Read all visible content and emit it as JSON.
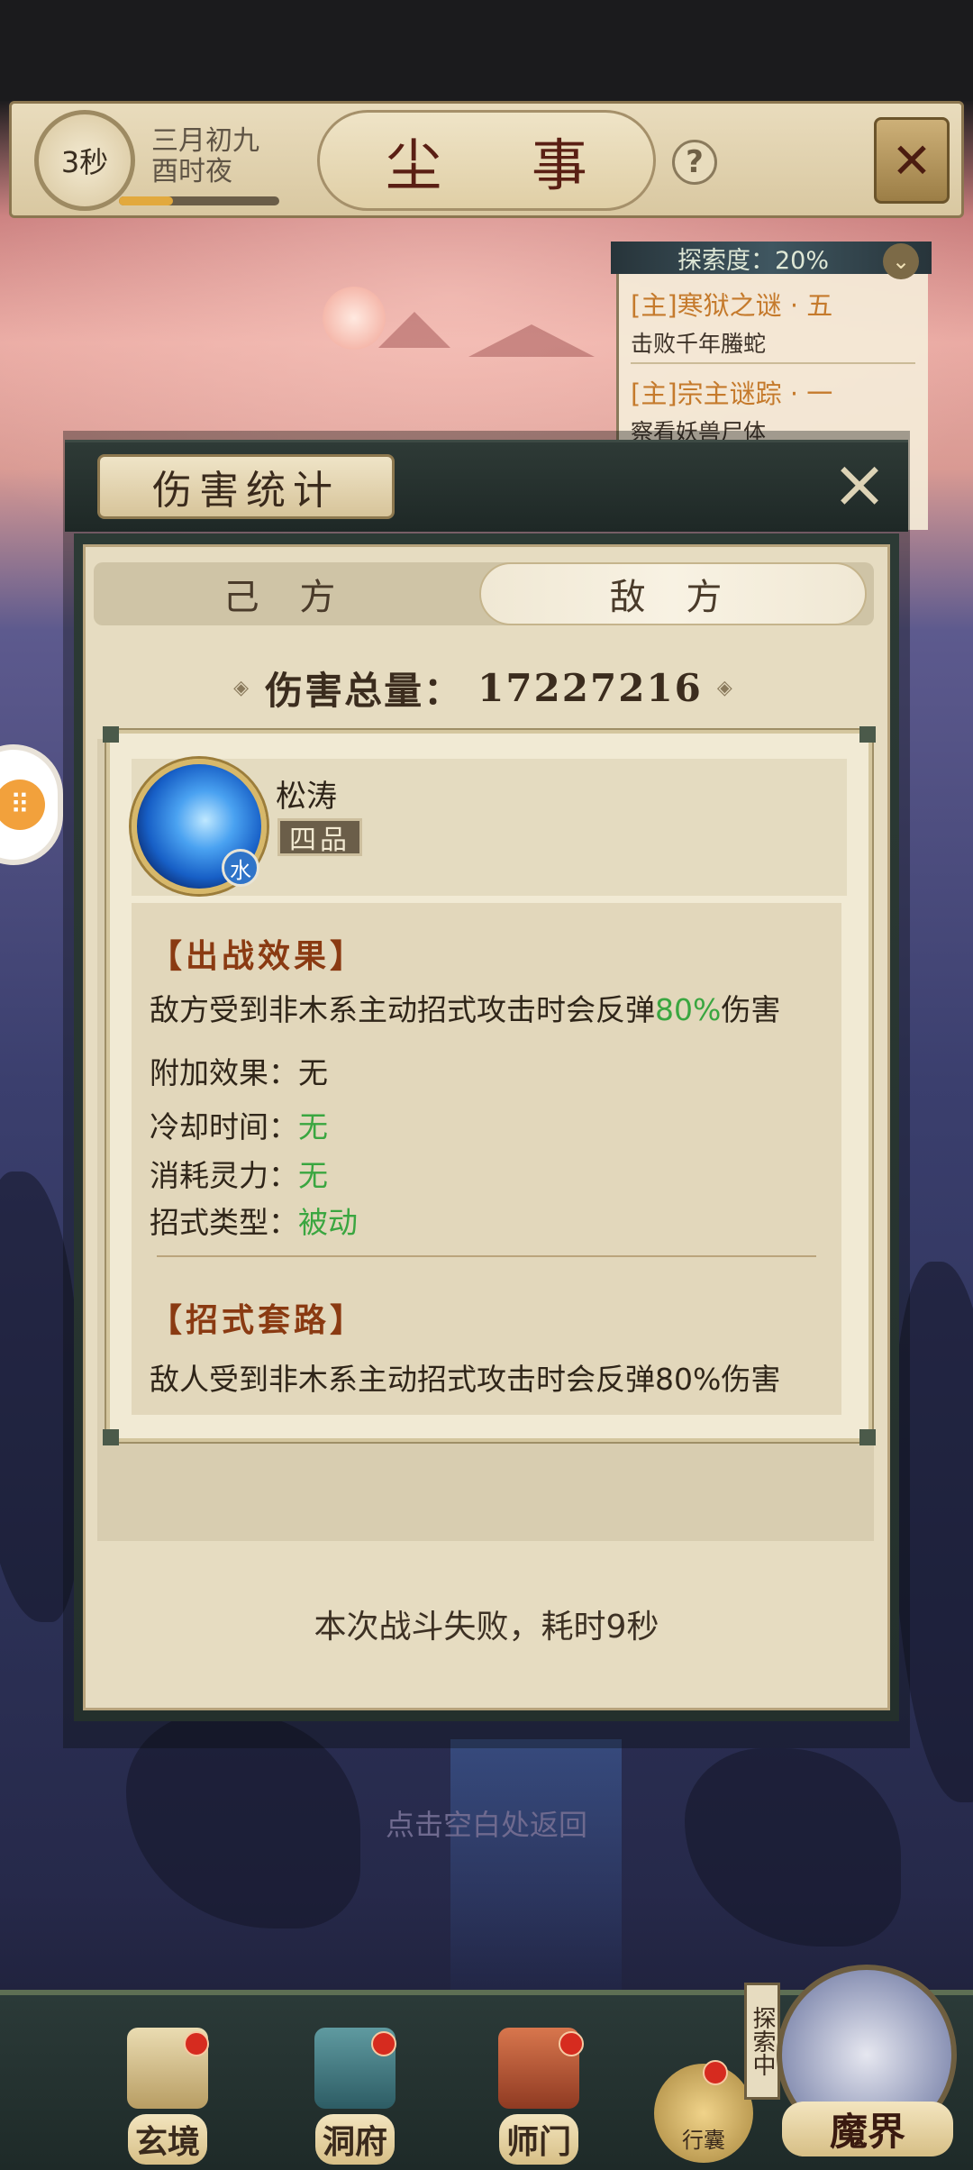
{
  "header": {
    "time_seconds": "3秒",
    "date_line1": "三月初九",
    "date_line2": "酉时夜",
    "title": "尘 事",
    "help_icon": "question-mark-icon",
    "map_icon": "crossed-swords-icon"
  },
  "quest_panel": {
    "explore_label": "探索度：20%",
    "explore_progress": 0.2,
    "quests": [
      {
        "title": "[主]寒狱之谜 · 五",
        "subtitle": "击败千年螣蛇"
      },
      {
        "title": "[主]宗主谜踪 · 一",
        "subtitle": "察看妖兽尸体"
      }
    ]
  },
  "modal": {
    "title": "伤害统计",
    "tabs": [
      {
        "label": "己 方",
        "active": false
      },
      {
        "label": "敌 方",
        "active": true
      }
    ],
    "total_label": "伤害总量：",
    "total_value": "17227216",
    "result_text": "本次战斗失败，耗时9秒"
  },
  "skill": {
    "name": "松涛",
    "grade": "四品",
    "element": "水",
    "effect_section_title": "【出战效果】",
    "effect_desc_prefix": "敌方受到非木系主动招式攻击时会反弹",
    "effect_desc_percent": "80%",
    "effect_desc_suffix": "伤害",
    "extra_label": "附加效果：",
    "extra_value": "无",
    "cooldown_label": "冷却时间：",
    "cooldown_value": "无",
    "cost_label": "消耗灵力：",
    "cost_value": "无",
    "type_label": "招式类型：",
    "type_value": "被动",
    "routine_section_title": "【招式套路】",
    "routine_desc": "敌人受到非木系主动招式攻击时会反弹80%伤害"
  },
  "hint": "点击空白处返回",
  "bottom_nav": {
    "items": [
      {
        "label": "玄境",
        "has_alert": true
      },
      {
        "label": "洞府",
        "has_alert": true
      },
      {
        "label": "师门",
        "has_alert": true
      }
    ],
    "bag_label": "行囊",
    "exploring_tag": "探索中",
    "realm_label": "魔界"
  },
  "colors": {
    "accent_green": "#3aa640",
    "section_title": "#8a3a12",
    "quest_title": "#c57a2c",
    "alert_red": "#d62b1f"
  }
}
